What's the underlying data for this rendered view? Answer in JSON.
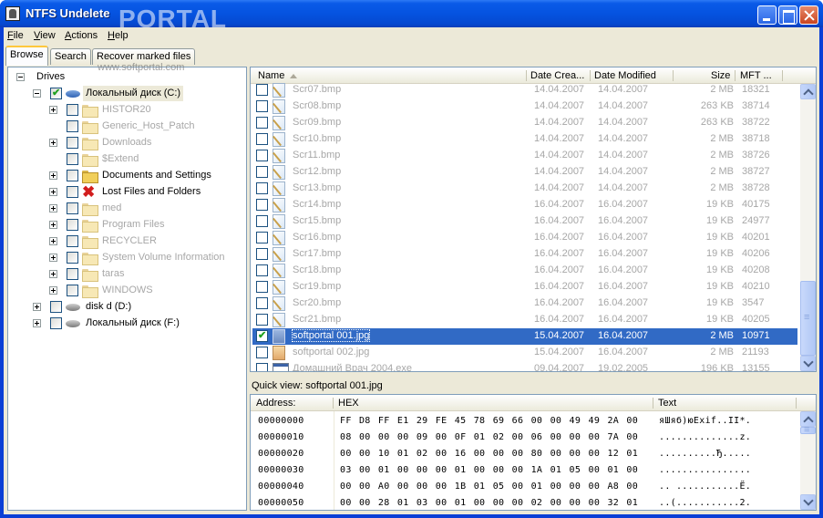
{
  "window": {
    "title": "NTFS Undelete",
    "watermark": "PORTAL",
    "watermark_url": "www.softportal.com"
  },
  "menu": [
    {
      "label": "File",
      "mnemonic": "F",
      "rest": "ile"
    },
    {
      "label": "View",
      "mnemonic": "V",
      "rest": "iew"
    },
    {
      "label": "Actions",
      "mnemonic": "A",
      "rest": "ctions"
    },
    {
      "label": "Help",
      "mnemonic": "H",
      "rest": "elp"
    }
  ],
  "tabs": [
    {
      "label": "Browse",
      "active": true
    },
    {
      "label": "Search",
      "active": false
    },
    {
      "label": "Recover marked files",
      "active": false
    }
  ],
  "tree": {
    "root_label": "Drives",
    "drives": [
      {
        "label": "Локальный диск (C:)",
        "checked": true,
        "expanded": true,
        "children": [
          {
            "label": "HISTOR20",
            "expandable": true,
            "dim": true
          },
          {
            "label": "Generic_Host_Patch",
            "expandable": false,
            "dim": true
          },
          {
            "label": "Downloads",
            "expandable": true,
            "dim": true
          },
          {
            "label": "$Extend",
            "expandable": false,
            "dim": true
          },
          {
            "label": "Documents and Settings",
            "expandable": true,
            "dim": false
          },
          {
            "label": "Lost Files and Folders",
            "expandable": true,
            "dim": false,
            "icon": "lost-icon"
          },
          {
            "label": "med",
            "expandable": true,
            "dim": true
          },
          {
            "label": "Program Files",
            "expandable": true,
            "dim": true
          },
          {
            "label": "RECYCLER",
            "expandable": true,
            "dim": true
          },
          {
            "label": "System Volume Information",
            "expandable": true,
            "dim": true
          },
          {
            "label": "taras",
            "expandable": true,
            "dim": true
          },
          {
            "label": "WINDOWS",
            "expandable": true,
            "dim": true
          }
        ]
      },
      {
        "label": "disk d (D:)",
        "checked": false,
        "expanded": false
      },
      {
        "label": "Локальный диск (F:)",
        "checked": false,
        "expanded": false
      }
    ]
  },
  "file_list": {
    "columns": [
      "Name",
      "Date Crea...",
      "Date Modified",
      "Size",
      "MFT ..."
    ],
    "rows": [
      {
        "name": "Scr07.bmp",
        "created": "14.04.2007",
        "modified": "14.04.2007",
        "size": "2 MB",
        "mft": "18321",
        "type": "bmp",
        "checked": false
      },
      {
        "name": "Scr08.bmp",
        "created": "14.04.2007",
        "modified": "14.04.2007",
        "size": "263 KB",
        "mft": "38714",
        "type": "bmp",
        "checked": false
      },
      {
        "name": "Scr09.bmp",
        "created": "14.04.2007",
        "modified": "14.04.2007",
        "size": "263 KB",
        "mft": "38722",
        "type": "bmp",
        "checked": false
      },
      {
        "name": "Scr10.bmp",
        "created": "14.04.2007",
        "modified": "14.04.2007",
        "size": "2 MB",
        "mft": "38718",
        "type": "bmp",
        "checked": false
      },
      {
        "name": "Scr11.bmp",
        "created": "14.04.2007",
        "modified": "14.04.2007",
        "size": "2 MB",
        "mft": "38726",
        "type": "bmp",
        "checked": false
      },
      {
        "name": "Scr12.bmp",
        "created": "14.04.2007",
        "modified": "14.04.2007",
        "size": "2 MB",
        "mft": "38727",
        "type": "bmp",
        "checked": false
      },
      {
        "name": "Scr13.bmp",
        "created": "14.04.2007",
        "modified": "14.04.2007",
        "size": "2 MB",
        "mft": "38728",
        "type": "bmp",
        "checked": false
      },
      {
        "name": "Scr14.bmp",
        "created": "16.04.2007",
        "modified": "16.04.2007",
        "size": "19 KB",
        "mft": "40175",
        "type": "bmp",
        "checked": false
      },
      {
        "name": "Scr15.bmp",
        "created": "16.04.2007",
        "modified": "16.04.2007",
        "size": "19 KB",
        "mft": "24977",
        "type": "bmp",
        "checked": false
      },
      {
        "name": "Scr16.bmp",
        "created": "16.04.2007",
        "modified": "16.04.2007",
        "size": "19 KB",
        "mft": "40201",
        "type": "bmp",
        "checked": false
      },
      {
        "name": "Scr17.bmp",
        "created": "16.04.2007",
        "modified": "16.04.2007",
        "size": "19 KB",
        "mft": "40206",
        "type": "bmp",
        "checked": false
      },
      {
        "name": "Scr18.bmp",
        "created": "16.04.2007",
        "modified": "16.04.2007",
        "size": "19 KB",
        "mft": "40208",
        "type": "bmp",
        "checked": false
      },
      {
        "name": "Scr19.bmp",
        "created": "16.04.2007",
        "modified": "16.04.2007",
        "size": "19 KB",
        "mft": "40210",
        "type": "bmp",
        "checked": false
      },
      {
        "name": "Scr20.bmp",
        "created": "16.04.2007",
        "modified": "16.04.2007",
        "size": "19 KB",
        "mft": "3547",
        "type": "bmp",
        "checked": false
      },
      {
        "name": "Scr21.bmp",
        "created": "16.04.2007",
        "modified": "16.04.2007",
        "size": "19 KB",
        "mft": "40205",
        "type": "bmp",
        "checked": false
      },
      {
        "name": "softportal 001.jpg",
        "created": "15.04.2007",
        "modified": "16.04.2007",
        "size": "2 MB",
        "mft": "10971",
        "type": "jpg",
        "checked": true,
        "selected": true
      },
      {
        "name": "softportal 002.jpg",
        "created": "15.04.2007",
        "modified": "16.04.2007",
        "size": "2 MB",
        "mft": "21193",
        "type": "jpg",
        "checked": false
      },
      {
        "name": "Домашний Врач 2004.exe",
        "created": "09.04.2007",
        "modified": "19.02.2005",
        "size": "196 KB",
        "mft": "13155",
        "type": "exe",
        "checked": false
      }
    ]
  },
  "quick_view": {
    "label": "Quick view: softportal 001.jpg"
  },
  "hex_view": {
    "columns": [
      "Address:",
      "HEX",
      "Text"
    ],
    "rows": [
      {
        "address": "00000000",
        "hex": "FF D8 FF E1 29 FE 45 78 69 66 00 00 49 49 2A 00",
        "text": "яШяб)юExif..II*."
      },
      {
        "address": "00000010",
        "hex": "08 00 00 00 09 00 0F 01 02 00 06 00 00 00 7A 00",
        "text": "..............z."
      },
      {
        "address": "00000020",
        "hex": "00 00 10 01 02 00 16 00 00 00 80 00 00 00 12 01",
        "text": "..........Ђ....."
      },
      {
        "address": "00000030",
        "hex": "03 00 01 00 00 00 01 00 00 00 1A 01 05 00 01 00",
        "text": "................"
      },
      {
        "address": "00000040",
        "hex": "00 00 A0 00 00 00 1B 01 05 00 01 00 00 00 A8 00",
        "text": ".. ...........Ё."
      },
      {
        "address": "00000050",
        "hex": "00 00 28 01 03 00 01 00 00 00 02 00 00 00 32 01",
        "text": "..(...........2."
      }
    ]
  }
}
